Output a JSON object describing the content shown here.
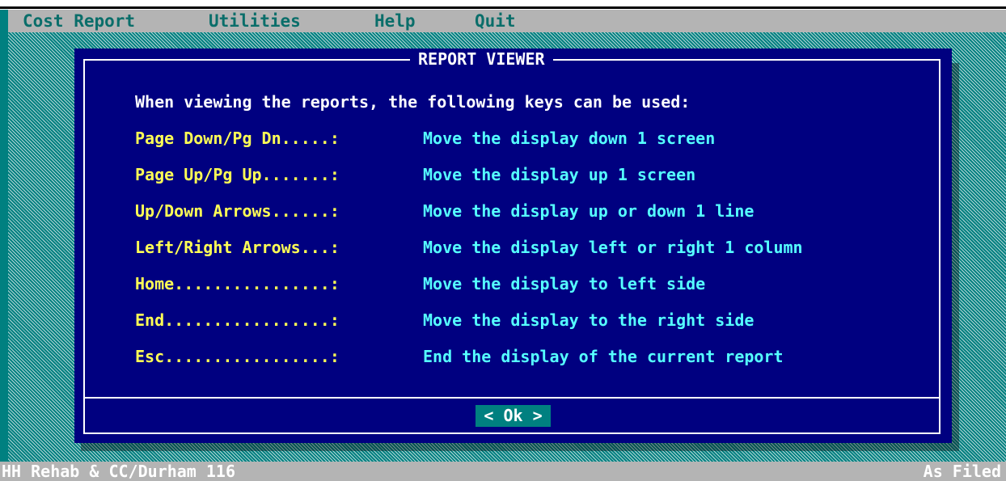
{
  "menu": {
    "items": [
      {
        "label": "Cost Report"
      },
      {
        "label": "Utilities"
      },
      {
        "label": "Help"
      },
      {
        "label": "Quit"
      }
    ]
  },
  "dialog": {
    "title": "REPORT VIEWER",
    "intro": "When viewing the reports, the following keys can be used:",
    "keys": [
      {
        "key": "Page Down/Pg Dn.....:",
        "description": "Move the display down 1 screen"
      },
      {
        "key": "Page Up/Pg Up.......:",
        "description": "Move the display up 1 screen"
      },
      {
        "key": "Up/Down Arrows......:",
        "description": "Move the display up or down 1 line"
      },
      {
        "key": "Left/Right Arrows...:",
        "description": "Move the display left or right 1 column"
      },
      {
        "key": "Home................:",
        "description": "Move the display to left side"
      },
      {
        "key": "End.................:",
        "description": "Move the display to the right side"
      },
      {
        "key": "Esc.................:",
        "description": "End the display of the current report"
      }
    ],
    "ok_label": "< Ok >"
  },
  "status": {
    "left": "HH Rehab & CC/Durham 116",
    "right": "As Filed"
  },
  "colors": {
    "background": "#008080",
    "menubar": "#b4b4b4",
    "menu_text": "#0a6e6a",
    "dialog_bg": "#000080",
    "key_text": "#ffff55",
    "description_text": "#55ffff",
    "button_bg": "#008080"
  }
}
